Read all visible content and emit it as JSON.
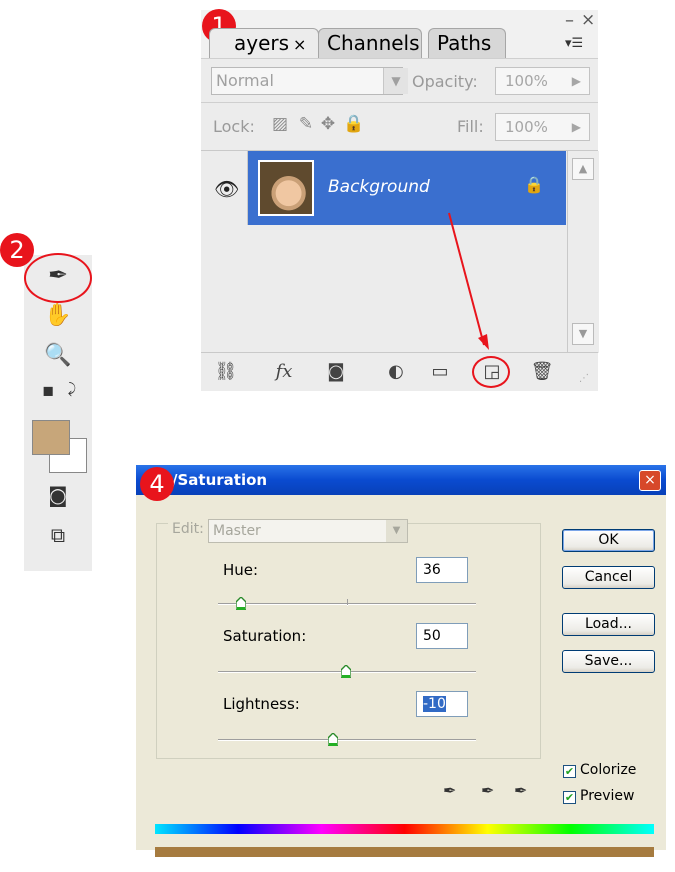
{
  "annotations": {
    "badge1": "1",
    "badge2": "2",
    "badge4": "4",
    "color": "#e8141c"
  },
  "layers_panel": {
    "tabs": [
      {
        "label": "Layers",
        "close": "×"
      },
      {
        "label": "Channels"
      },
      {
        "label": "Paths"
      }
    ],
    "tab_layers_visible": "ayers",
    "minimize": "–",
    "close": "×",
    "menu": "▾☰",
    "blend_mode": "Normal",
    "opacity_label": "Opacity:",
    "opacity_value": "100%",
    "lock_label": "Lock:",
    "fill_label": "Fill:",
    "fill_value": "100%",
    "layer": {
      "name": "Background",
      "visible_icon": "eye-icon",
      "locked_icon": "lock-icon"
    },
    "footer_icons": [
      "link-icon",
      "fx-icon",
      "mask-icon",
      "adjustment-icon",
      "folder-icon",
      "new-layer-icon",
      "trash-icon"
    ],
    "fx_label": "fx"
  },
  "toolbox": {
    "tools": [
      "eyedropper-icon",
      "hand-icon",
      "zoom-icon",
      "default-colors-icon",
      "swap-colors-icon",
      "quick-mask-icon",
      "screen-mode-icon"
    ],
    "foreground_color": "#c7a67a",
    "background_color": "#ffffff"
  },
  "hue_saturation": {
    "title": "/Saturation",
    "close": "×",
    "edit_label": "Edit:",
    "edit_value": "Master",
    "hue_label": "Hue:",
    "hue_value": "36",
    "saturation_label": "Saturation:",
    "saturation_value": "50",
    "lightness_label": "Lightness:",
    "lightness_value": "-10",
    "buttons": {
      "ok": "OK",
      "cancel": "Cancel",
      "load": "Load...",
      "save": "Save..."
    },
    "colorize_label": "Colorize",
    "colorize_checked": true,
    "preview_label": "Preview",
    "preview_checked": true,
    "slider_positions": {
      "hue": 0.12,
      "saturation": 0.5,
      "lightness": 0.45
    }
  }
}
